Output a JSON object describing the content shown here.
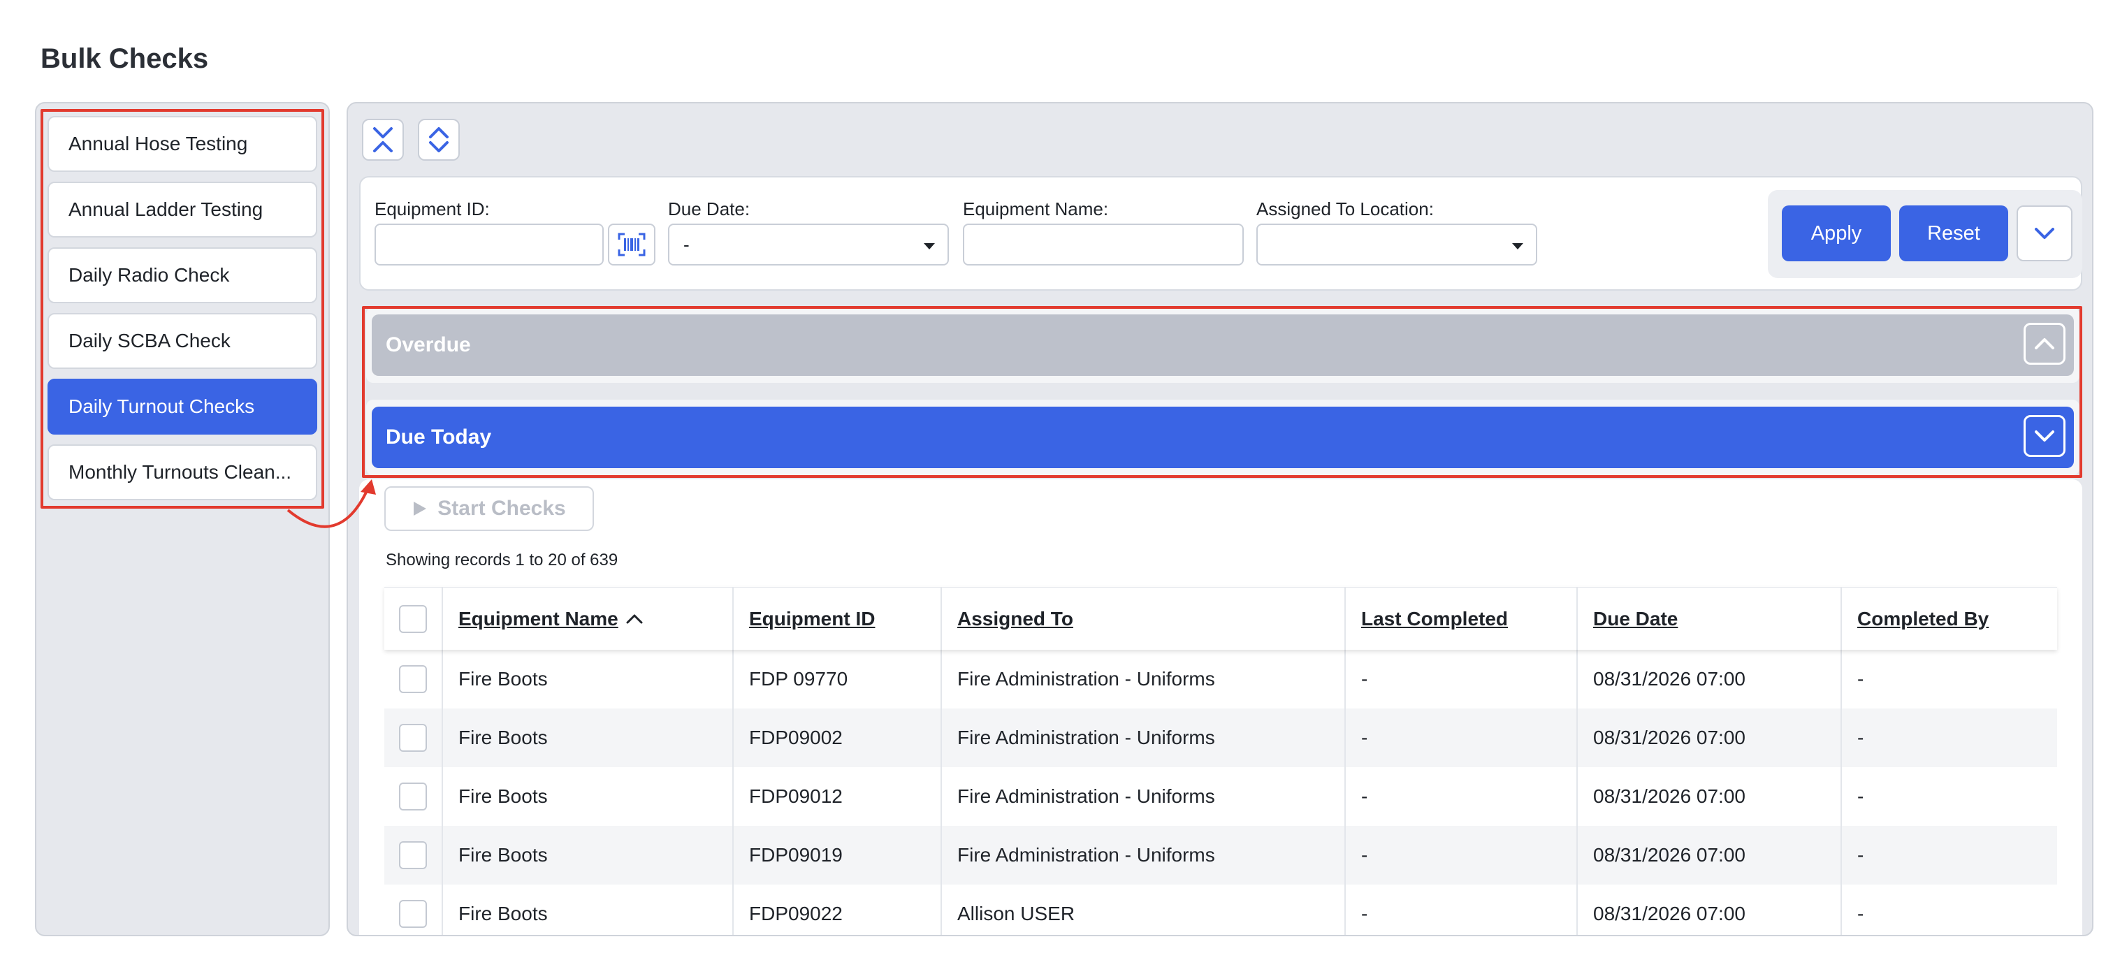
{
  "page_title": "Bulk Checks",
  "sidebar": {
    "items": [
      {
        "label": "Annual Hose Testing",
        "active": false
      },
      {
        "label": "Annual Ladder Testing",
        "active": false
      },
      {
        "label": "Daily Radio Check",
        "active": false
      },
      {
        "label": "Daily SCBA Check",
        "active": false
      },
      {
        "label": "Daily Turnout Checks",
        "active": true
      },
      {
        "label": "Monthly Turnouts Clean..."
      }
    ]
  },
  "toolbar": {
    "collapse_all_icon": "collapse-all-icon",
    "expand_all_icon": "expand-all-icon"
  },
  "filters": {
    "equipment_id_label": "Equipment ID:",
    "equipment_id_value": "",
    "barcode_icon": "barcode-scan-icon",
    "due_date_label": "Due Date:",
    "due_date_value": "-",
    "equipment_name_label": "Equipment Name:",
    "equipment_name_value": "",
    "assigned_location_label": "Assigned To Location:",
    "assigned_location_value": "",
    "apply_label": "Apply",
    "reset_label": "Reset"
  },
  "sections": {
    "overdue_label": "Overdue",
    "due_today_label": "Due Today"
  },
  "start_checks_label": "Start Checks",
  "records_text": "Showing records 1 to 20 of 639",
  "table": {
    "columns": [
      "Equipment Name",
      "Equipment ID",
      "Assigned To",
      "Last Completed",
      "Due Date",
      "Completed By"
    ],
    "rows": [
      [
        "Fire Boots",
        "FDP 09770",
        "Fire Administration - Uniforms",
        "-",
        "08/31/2026 07:00",
        "-"
      ],
      [
        "Fire Boots",
        "FDP09002",
        "Fire Administration - Uniforms",
        "-",
        "08/31/2026 07:00",
        "-"
      ],
      [
        "Fire Boots",
        "FDP09012",
        "Fire Administration - Uniforms",
        "-",
        "08/31/2026 07:00",
        "-"
      ],
      [
        "Fire Boots",
        "FDP09019",
        "Fire Administration - Uniforms",
        "-",
        "08/31/2026 07:00",
        "-"
      ],
      [
        "Fire Boots",
        "FDP09022",
        "Allison USER",
        "-",
        "08/31/2026 07:00",
        "-"
      ]
    ]
  },
  "colors": {
    "accent": "#3a64e4",
    "highlight": "#e23a2e",
    "overdue_bar": "#bdc1cb"
  }
}
